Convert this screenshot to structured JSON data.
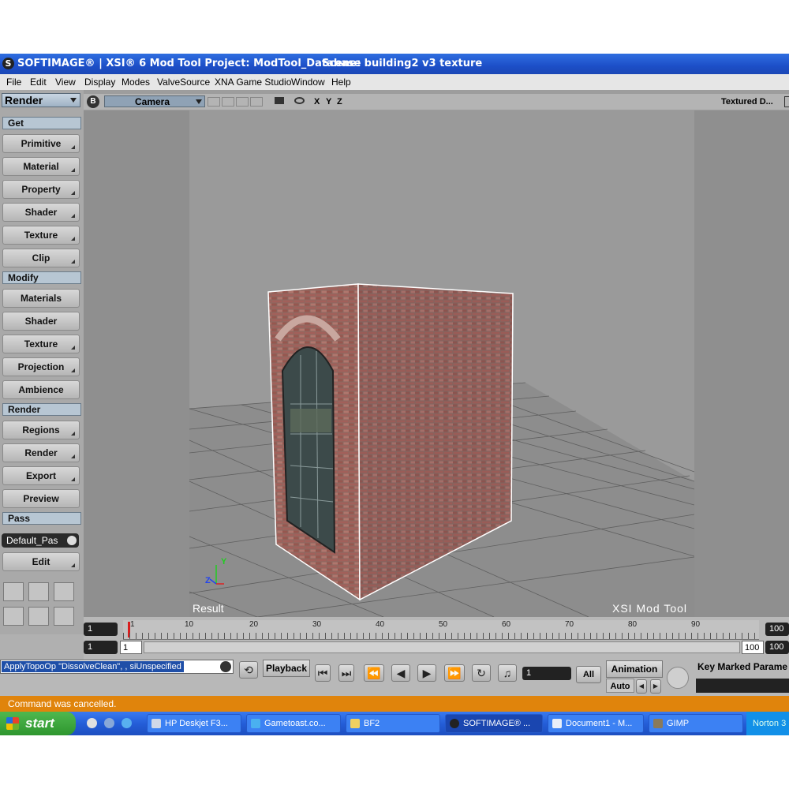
{
  "titlebar": {
    "title": "SOFTIMAGE® | XSI® 6 Mod Tool Project: ModTool_Database",
    "scene": "Scene: building2 v3  texture"
  },
  "menu": [
    "File",
    "Edit",
    "View",
    "Display",
    "Modes",
    "ValveSource",
    "XNA Game Studio",
    "Window",
    "Help"
  ],
  "left_panel": {
    "module": "Render",
    "sections": {
      "get": "Get",
      "modify": "Modify",
      "render": "Render",
      "pass": "Pass"
    },
    "get_buttons": [
      "Primitive",
      "Material",
      "Property",
      "Shader",
      "Texture",
      "Clip"
    ],
    "modify_buttons": [
      "Materials",
      "Shader",
      "Texture",
      "Projection",
      "Ambience"
    ],
    "render_buttons": [
      "Regions",
      "Render",
      "Export",
      "Preview"
    ],
    "pass_value": "Default_Pas",
    "edit_button": "Edit"
  },
  "viewport": {
    "badge": "B",
    "camera": "Camera",
    "axes": [
      "X",
      "Y",
      "Z"
    ],
    "display_mode": "Textured D...",
    "label_left": "Result",
    "label_right": "XSI  Mod  Tool",
    "gizmo_y": "Y",
    "gizmo_z": "Z"
  },
  "timeline": {
    "start_frame": "1",
    "start_frame2": "1",
    "range_start": "1",
    "range_end": "100",
    "end_frame": "100",
    "end_frame2": "100",
    "ticks": [
      "1",
      "10",
      "20",
      "30",
      "40",
      "50",
      "60",
      "70",
      "80",
      "90"
    ]
  },
  "command_line": "ApplyTopoOp \"DissolveClean\", , siUnspecified",
  "playback": {
    "label": "Playback",
    "current_frame": "1",
    "all_label": "All",
    "animation_label": "Animation",
    "auto_label": "Auto",
    "key_label": "Key Marked Parame"
  },
  "status": "Command was cancelled.",
  "taskbar": {
    "start": "start",
    "items": [
      "HP Deskjet F3...",
      "Gametoast.co...",
      "BF2",
      "SOFTIMAGE® ...",
      "Document1 - M...",
      "GIMP"
    ],
    "tray": "Norton 3"
  },
  "colors": {
    "title_blue": "#1d4fc8",
    "status_orange": "#e0840c",
    "taskbar_blue": "#245ed8"
  }
}
